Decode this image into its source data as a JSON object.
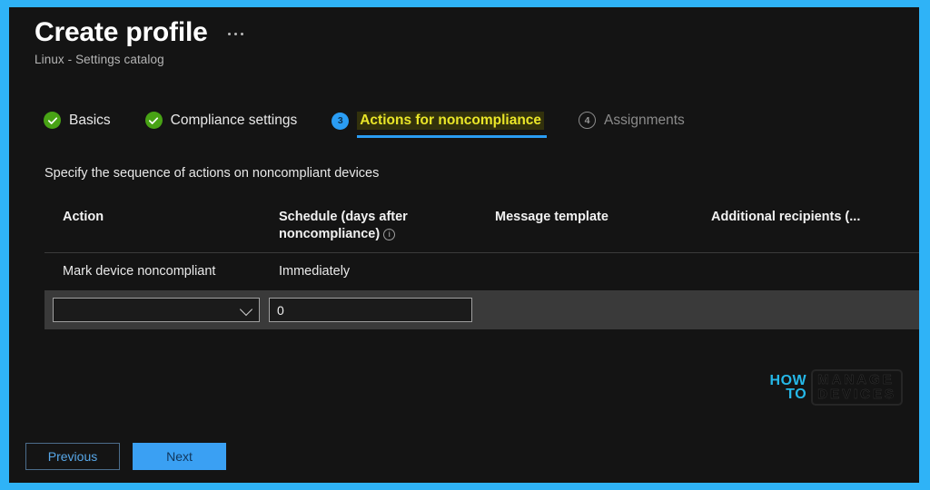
{
  "window": {
    "title": "Create profile",
    "subtitle": "Linux - Settings catalog",
    "overflow_menu": "…"
  },
  "colors": {
    "frame": "#2fb3f7",
    "panel_bg": "#141414",
    "accent_blue": "#2a9df4",
    "active_tab_text": "#eae628",
    "active_tab_bg": "#32310c",
    "step_done": "#48a315",
    "row_highlight": "#3a3a3a",
    "next_button": "#3aa0f3",
    "watermark_cyan": "#25b8e8"
  },
  "wizard": {
    "steps": [
      {
        "number": "1",
        "label": "Basics",
        "state": "done",
        "icon": "check-icon"
      },
      {
        "number": "2",
        "label": "Compliance settings",
        "state": "done",
        "icon": "check-icon"
      },
      {
        "number": "3",
        "label": "Actions for noncompliance",
        "state": "active",
        "icon": "step-number"
      },
      {
        "number": "4",
        "label": "Assignments",
        "state": "pending",
        "icon": "step-number"
      }
    ]
  },
  "main": {
    "instruction": "Specify the sequence of actions on noncompliant devices",
    "table": {
      "headers": [
        "Action",
        "Schedule (days after noncompliance)",
        "Message template",
        "Additional recipients (..."
      ],
      "schedule_info_icon": "info-icon",
      "rows": [
        {
          "action": "Mark device noncompliant",
          "schedule": "Immediately",
          "message_template": "",
          "additional_recipients": ""
        }
      ],
      "edit_row": {
        "action_select_value": "",
        "action_select_icon": "chevron-down-icon",
        "schedule_value": "0",
        "schedule_placeholder": "0"
      }
    }
  },
  "watermark": {
    "how": "HOW",
    "to": "TO",
    "manage": "MANAGE",
    "devices": "DEVICES"
  },
  "footer": {
    "previous_label": "Previous",
    "next_label": "Next"
  }
}
